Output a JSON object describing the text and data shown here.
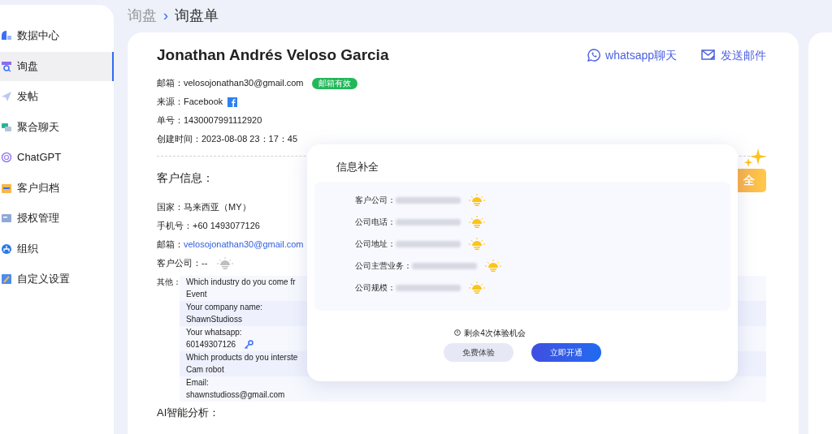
{
  "sidebar": {
    "items": [
      {
        "label": "数据中心",
        "selected": false
      },
      {
        "label": "询盘",
        "selected": true
      },
      {
        "label": "发帖",
        "selected": false
      },
      {
        "label": "聚合聊天",
        "selected": false
      },
      {
        "label": "ChatGPT",
        "selected": false
      },
      {
        "label": "客户归档",
        "selected": false
      },
      {
        "label": "授权管理",
        "selected": false
      },
      {
        "label": "组织",
        "selected": false
      },
      {
        "label": "自定义设置",
        "selected": false
      }
    ]
  },
  "breadcrumb": {
    "items": [
      "询盘",
      "询盘单"
    ],
    "separator": "›"
  },
  "header": {
    "name": "Jonathan Andrés Veloso Garcia",
    "actions": [
      {
        "label": "whatsapp聊天"
      },
      {
        "label": "发送邮件"
      }
    ]
  },
  "details": [
    {
      "label": "邮箱：",
      "value": "velosojonathan30@gmail.com",
      "kind": "badge",
      "badge": "邮箱有效"
    },
    {
      "label": "来源：",
      "value": "Facebook",
      "kind": "brand"
    },
    {
      "label": "单号：",
      "value": "1430007991112920",
      "kind": "text"
    },
    {
      "label": "创建时间：",
      "value": "2023-08-08 23：17：45",
      "kind": "text"
    }
  ],
  "customer_info": {
    "title": "客户信息：",
    "fields": [
      {
        "label": "国家：",
        "value": "马来西亚（MY）",
        "kind": "text"
      },
      {
        "label": "手机号：",
        "value": "+60  1493077126",
        "kind": "text"
      },
      {
        "label": "邮箱：",
        "value": "velosojonathan30@gmail.com",
        "kind": "link"
      },
      {
        "label": "客户公司：",
        "value": "--",
        "kind": "bulb"
      }
    ],
    "other": {
      "label": "其他：",
      "rows": [
        {
          "question": "Which industry do you come fr",
          "answer": "Event",
          "kind": "text"
        },
        {
          "question": "Your company name:",
          "answer": "ShawnStudioss",
          "kind": "text"
        },
        {
          "question": "Your whatsapp:",
          "answer": "60149307126",
          "kind": "tool"
        },
        {
          "question": "Which products do you interste",
          "answer": "Cam robot",
          "kind": "text"
        },
        {
          "question": "Email:",
          "answer": "shawnstudioss@gmail.com",
          "kind": "text"
        }
      ]
    }
  },
  "enrich_button": {
    "label": "全"
  },
  "ai_section": {
    "title": "AI智能分析："
  },
  "popup": {
    "title": "信息补全",
    "fields": [
      {
        "label": "客户公司："
      },
      {
        "label": "公司电话："
      },
      {
        "label": "公司地址："
      },
      {
        "label": "公司主营业务："
      },
      {
        "label": "公司规模："
      }
    ],
    "note": "剩余4次体验机会",
    "buttons": [
      {
        "label": "免费体验",
        "kind": "secondary"
      },
      {
        "label": "立即开通",
        "kind": "primary"
      }
    ]
  }
}
